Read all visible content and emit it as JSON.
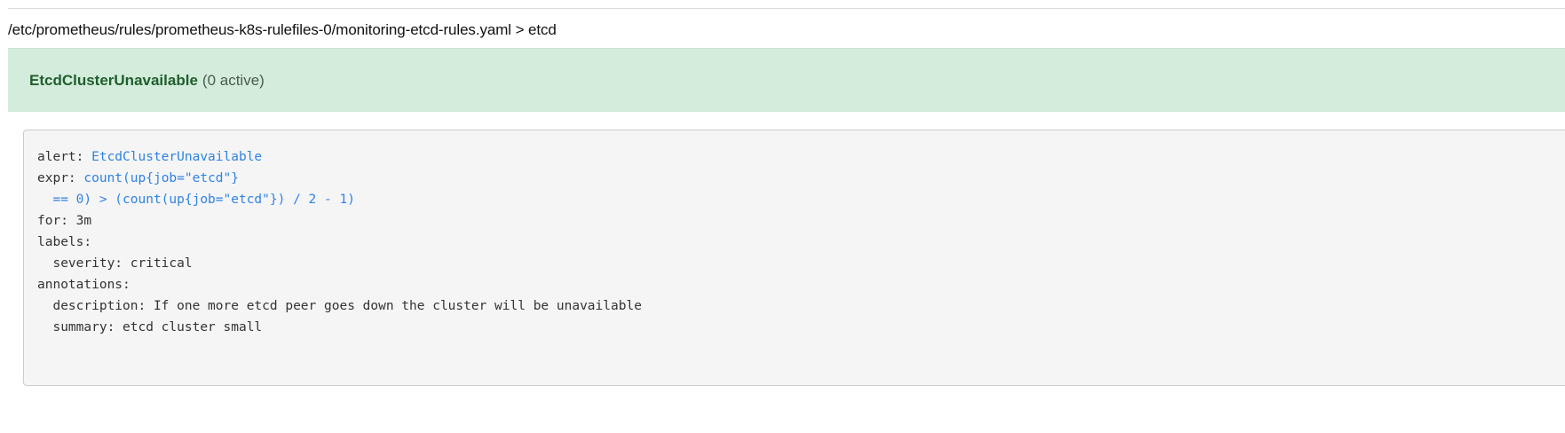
{
  "colors": {
    "group_header_background": "#ffffff",
    "alert_row_background": "#d4ecdb",
    "alert_name_color": "#1f5e2e",
    "code_background": "#f5f5f5",
    "code_link_color": "#2f82e5"
  },
  "rule_group": {
    "path": "/etc/prometheus/rules/prometheus-k8s-rulefiles-0/monitoring-etcd-rules.yaml > etcd"
  },
  "alert": {
    "name": "EtcdClusterUnavailable",
    "active_count": "(0 active)",
    "state": "inactive"
  },
  "definition": {
    "alert_key": "alert: ",
    "alert_value": "EtcdClusterUnavailable",
    "expr_key": "expr: ",
    "expr_line_1": "count(up{job=\"etcd\"}",
    "expr_line_2": "  == 0) > (count(up{job=\"etcd\"}) / 2 - 1)",
    "for_line": "for: 3m",
    "labels_key": "labels:",
    "severity_line": "  severity: critical",
    "annotations_key": "annotations:",
    "description_line": "  description: If one more etcd peer goes down the cluster will be unavailable",
    "summary_line": "  summary: etcd cluster small"
  }
}
